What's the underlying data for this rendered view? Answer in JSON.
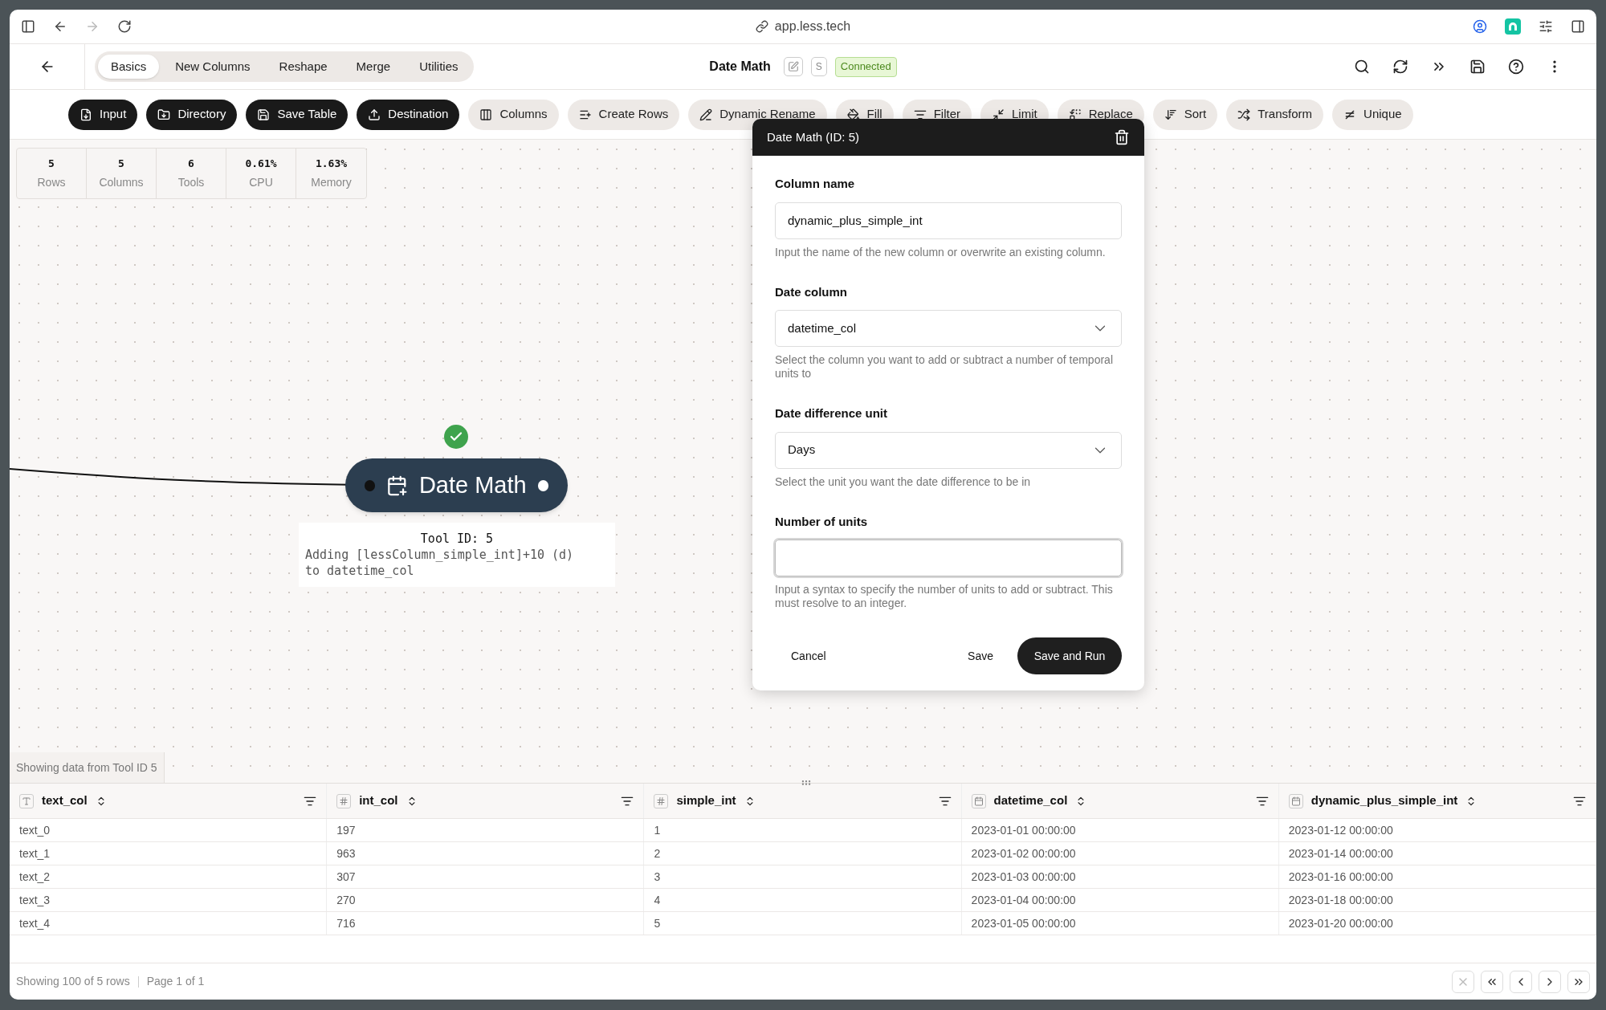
{
  "browser": {
    "url": "app.less.tech"
  },
  "header": {
    "tabs": [
      {
        "label": "Basics",
        "selected": true
      },
      {
        "label": "New Columns",
        "selected": false
      },
      {
        "label": "Reshape",
        "selected": false
      },
      {
        "label": "Merge",
        "selected": false
      },
      {
        "label": "Utilities",
        "selected": false
      }
    ],
    "title": "Date Math",
    "short_button": "S",
    "status": "Connected"
  },
  "toolbar": [
    {
      "label": "Input",
      "kind": "primary"
    },
    {
      "label": "Directory",
      "kind": "primary"
    },
    {
      "label": "Save Table",
      "kind": "primary"
    },
    {
      "label": "Destination",
      "kind": "primary"
    },
    {
      "label": "Columns",
      "kind": "secondary"
    },
    {
      "label": "Create Rows",
      "kind": "secondary"
    },
    {
      "label": "Dynamic Rename",
      "kind": "secondary"
    },
    {
      "label": "Fill",
      "kind": "secondary"
    },
    {
      "label": "Filter",
      "kind": "secondary"
    },
    {
      "label": "Limit",
      "kind": "secondary"
    },
    {
      "label": "Replace",
      "kind": "secondary"
    },
    {
      "label": "Sort",
      "kind": "secondary"
    },
    {
      "label": "Transform",
      "kind": "secondary"
    },
    {
      "label": "Unique",
      "kind": "secondary"
    }
  ],
  "stats": [
    {
      "value": "5",
      "label": "Rows"
    },
    {
      "value": "5",
      "label": "Columns"
    },
    {
      "value": "6",
      "label": "Tools"
    },
    {
      "value": "0.61%",
      "label": "CPU"
    },
    {
      "value": "1.63%",
      "label": "Memory"
    }
  ],
  "node": {
    "title": "Date Math",
    "succeeded": true
  },
  "node_info": {
    "title": "Tool ID: 5",
    "description": "Adding [lessColumn_simple_int]+10 (d) to datetime_col"
  },
  "dialog": {
    "title": "Date Math (ID: 5)",
    "fields": [
      {
        "kind": "text",
        "label": "Column name",
        "value": "dynamic_plus_simple_int",
        "help": "Input the name of the new column or overwrite an existing column.",
        "focused": false
      },
      {
        "kind": "select",
        "label": "Date column",
        "value": "datetime_col",
        "help": "Select the column you want to add or subtract a number of temporal units to",
        "focused": false
      },
      {
        "kind": "select",
        "label": "Date difference unit",
        "value": "Days",
        "help": "Select the unit you want the date difference to be in",
        "focused": false
      },
      {
        "kind": "text",
        "label": "Number of units",
        "help": "Input a syntax to specify the number of units to add or subtract. This must resolve to an integer.",
        "focused": true
      }
    ],
    "buttons": {
      "cancel": "Cancel",
      "save": "Save",
      "save_run": "Save and Run"
    }
  },
  "data_source": "Showing data from Tool ID 5",
  "table": {
    "columns": [
      {
        "name": "text_col",
        "kind": "text"
      },
      {
        "name": "int_col",
        "kind": "number"
      },
      {
        "name": "simple_int",
        "kind": "number"
      },
      {
        "name": "datetime_col",
        "kind": "date"
      },
      {
        "name": "dynamic_plus_simple_int",
        "kind": "date"
      }
    ],
    "rows": [
      [
        "text_0",
        "197",
        "1",
        "2023-01-01 00:00:00",
        "2023-01-12 00:00:00"
      ],
      [
        "text_1",
        "963",
        "2",
        "2023-01-02 00:00:00",
        "2023-01-14 00:00:00"
      ],
      [
        "text_2",
        "307",
        "3",
        "2023-01-03 00:00:00",
        "2023-01-16 00:00:00"
      ],
      [
        "text_3",
        "270",
        "4",
        "2023-01-04 00:00:00",
        "2023-01-18 00:00:00"
      ],
      [
        "text_4",
        "716",
        "5",
        "2023-01-05 00:00:00",
        "2023-01-20 00:00:00"
      ]
    ]
  },
  "footer": {
    "count": "Showing 100 of 5 rows",
    "page": "Page 1 of 1"
  }
}
